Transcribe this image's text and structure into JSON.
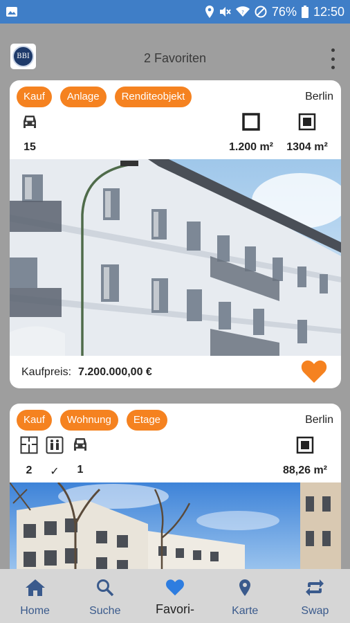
{
  "status_bar": {
    "battery": "76%",
    "time": "12:50"
  },
  "app_bar": {
    "logo_text": "BBI",
    "title": "2 Favoriten"
  },
  "listings": [
    {
      "tags": [
        "Kauf",
        "Anlage",
        "Renditeobjekt"
      ],
      "city": "Berlin",
      "stats": {
        "parking": "15",
        "area_living": "1.200 m²",
        "area_plot": "1304 m²"
      },
      "price_label": "Kaufpreis:",
      "price_value": "7.200.000,00 €",
      "favorite": true
    },
    {
      "tags": [
        "Kauf",
        "Wohnung",
        "Etage"
      ],
      "city": "Berlin",
      "stats": {
        "rooms": "2",
        "elevator": "✓",
        "parking": "1",
        "area": "88,26 m²"
      }
    }
  ],
  "bottom_nav": {
    "items": [
      {
        "label": "Home",
        "icon": "home-icon"
      },
      {
        "label": "Suche",
        "icon": "search-icon"
      },
      {
        "label": "Favori-",
        "icon": "heart-icon"
      },
      {
        "label": "Karte",
        "icon": "map-pin-icon"
      },
      {
        "label": "Swap",
        "icon": "swap-icon"
      }
    ],
    "active": "Favori-"
  },
  "colors": {
    "accent": "#f58220",
    "status_bar": "#3f7ec7",
    "nav_blue": "#3a5a8c",
    "active_blue": "#2e7de0"
  }
}
